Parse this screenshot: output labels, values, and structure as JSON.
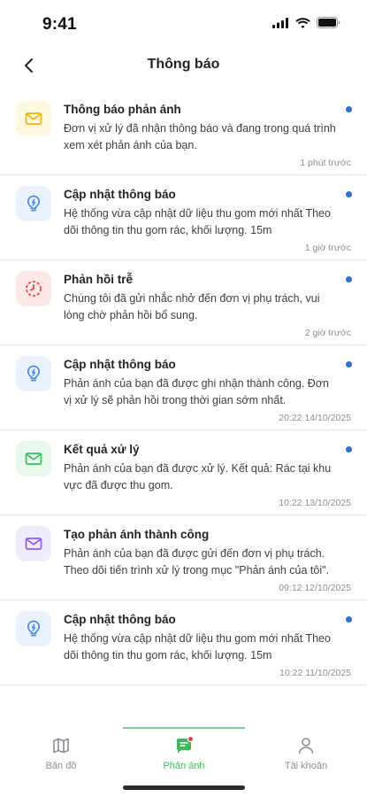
{
  "status_bar": {
    "time": "9:41"
  },
  "header": {
    "title": "Thông báo"
  },
  "notifications": [
    {
      "icon": "mail-icon",
      "icon_color": "#f0b400",
      "icon_bg": "#fff8e1",
      "title": "Thông báo phản ánh",
      "text": "Đơn vị xử lý đã nhận thông báo và đang trong quá trình xem xét phản ánh của bạn.",
      "time": "1 phút trước",
      "unread": true
    },
    {
      "icon": "bulb-icon",
      "icon_color": "#3b82f6",
      "icon_bg": "#eaf2fe",
      "title": "Cập nhật thông báo",
      "text": "Hệ thống vừa cập nhật dữ liệu thu gom mới nhất Theo dõi thông tin thu gom rác, khối lượng. 15m",
      "time": "1 giờ trước",
      "unread": true
    },
    {
      "icon": "clock-icon",
      "icon_color": "#e53935",
      "icon_bg": "#fde8e8",
      "title": "Phản hồi trễ",
      "text": "Chúng tôi đã gửi nhắc nhở đến đơn vị phụ trách, vui lòng chờ phản hồi bổ sung.",
      "time": "2 giờ trước",
      "unread": true
    },
    {
      "icon": "bulb-icon",
      "icon_color": "#3b82f6",
      "icon_bg": "#eaf2fe",
      "title": "Cập nhật thông báo",
      "text": "Phản ánh của bạn đã được ghi nhận thành công. Đơn vị xử lý sẽ phản hồi trong thời gian sớm nhất.",
      "time": "20:22 14/10/2025",
      "unread": true
    },
    {
      "icon": "mail-icon",
      "icon_color": "#34c25a",
      "icon_bg": "#e8f8ec",
      "title": "Kết quả xử lý",
      "text": "Phản ánh của bạn đã được xử lý. Kết quả: Rác tại khu vực đã được thu gom.",
      "time": "10:22 13/10/2025",
      "unread": true
    },
    {
      "icon": "mail-icon",
      "icon_color": "#8b5cf6",
      "icon_bg": "#f1ebfe",
      "title": "Tạo phản ánh thành công",
      "text": "Phản ánh của bạn đã được gửi đến đơn vị phụ trách. Theo dõi tiến trình xử lý trong mục \"Phản ánh của tôi\".",
      "time": "09:12 12/10/2025",
      "unread": false
    },
    {
      "icon": "bulb-icon",
      "icon_color": "#3b82f6",
      "icon_bg": "#eaf2fe",
      "title": "Cập nhật thông báo",
      "text": "Hệ thống vừa cập nhật dữ liệu thu gom mới nhất Theo dõi thông tin thu gom rác, khối lượng. 15m",
      "time": "10:22 11/10/2025",
      "unread": true
    }
  ],
  "bottom_nav": {
    "items": [
      {
        "label": "Bản đồ",
        "icon": "map-icon",
        "active": false
      },
      {
        "label": "Phản ánh",
        "icon": "feedback-icon",
        "active": true
      },
      {
        "label": "Tài khoản",
        "icon": "user-icon",
        "active": false
      }
    ]
  },
  "colors": {
    "accent": "#3fb95a",
    "unread_dot": "#2f6fe4",
    "notification_badge": "#e53935"
  }
}
